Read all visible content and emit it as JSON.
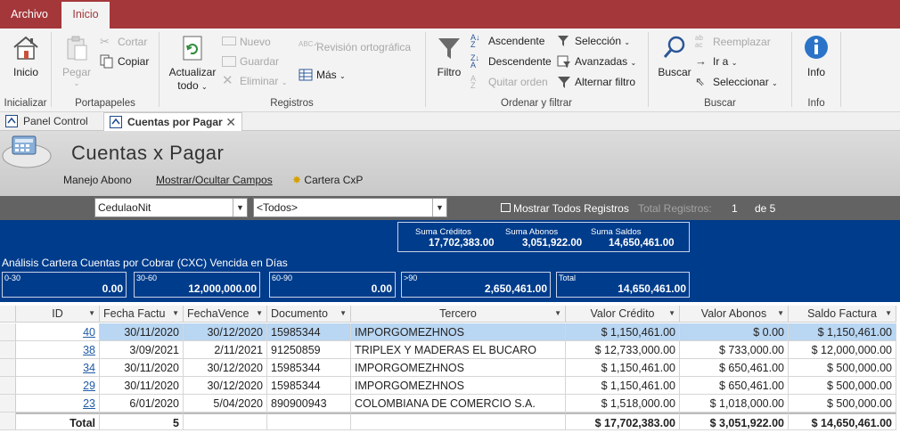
{
  "ribbon_tabs": {
    "file": "Archivo",
    "home": "Inicio"
  },
  "groups": {
    "inicializar": {
      "label": "Inicializar",
      "inicio_btn": "Inicio"
    },
    "portapapeles": {
      "label": "Portapapeles",
      "pegar": "Pegar",
      "cortar": "Cortar",
      "copiar": "Copiar"
    },
    "registros": {
      "label": "Registros",
      "actualizar_1": "Actualizar",
      "actualizar_2": "todo",
      "nuevo": "Nuevo",
      "guardar": "Guardar",
      "eliminar": "Eliminar",
      "ortografia": "Revisión ortográfica",
      "mas": "Más"
    },
    "ordenar": {
      "label": "Ordenar y filtrar",
      "filtro": "Filtro",
      "ascendente": "Ascendente",
      "descendente": "Descendente",
      "quitar": "Quitar orden",
      "seleccion": "Selección",
      "avanzadas": "Avanzadas",
      "alternar": "Alternar filtro"
    },
    "buscar": {
      "label": "Buscar",
      "buscar_btn": "Buscar",
      "reemplazar": "Reemplazar",
      "ira": "Ir a",
      "seleccionar": "Seleccionar"
    },
    "info": {
      "label": "Info",
      "info_btn": "Info"
    }
  },
  "doc_tabs": {
    "panel": "Panel Control",
    "cuentas": "Cuentas por Pagar"
  },
  "form": {
    "title": "Cuentas x Pagar",
    "btn_abono": "Manejo Abono",
    "btn_campos": "Mostrar/Ocultar Campos",
    "btn_cartera": "Cartera CxP"
  },
  "filter": {
    "field_combo": "CedulaoNit",
    "value_combo": "<Todos>",
    "show_all": "Mostrar Todos Registros",
    "total_label": "Total Registros:",
    "current": "1",
    "of_total": "de 5"
  },
  "sums": {
    "creditos_label": "Suma Créditos",
    "creditos": "17,702,383.00",
    "abonos_label": "Suma Abonos",
    "abonos": "3,051,922.00",
    "saldos_label": "Suma Saldos",
    "saldos": "14,650,461.00"
  },
  "analysis": {
    "label": "Análisis Cartera Cuentas por Cobrar (CXC) Vencida en Días",
    "b0_30_label": "0-30",
    "b0_30": "0.00",
    "b30_60_label": "30-60",
    "b30_60": "12,000,000.00",
    "b60_90_label": "60-90",
    "b60_90": "0.00",
    "b90_label": ">90",
    "b90": "2,650,461.00",
    "total_label": "Total",
    "total": "14,650,461.00"
  },
  "columns": [
    "ID",
    "Fecha Factu",
    "FechaVence",
    "Documento",
    "Tercero",
    "Valor Crédito",
    "Valor Abonos",
    "Saldo Factura"
  ],
  "rows": [
    [
      "40",
      "30/11/2020",
      "30/12/2020",
      "15985344",
      "IMPORGOMEZHNOS",
      "$ 1,150,461.00",
      "$ 0.00",
      "$ 1,150,461.00"
    ],
    [
      "38",
      "3/09/2021",
      "2/11/2021",
      "91250859",
      "TRIPLEX Y MADERAS EL BUCARO",
      "$ 12,733,000.00",
      "$ 733,000.00",
      "$ 12,000,000.00"
    ],
    [
      "34",
      "30/11/2020",
      "30/12/2020",
      "15985344",
      "IMPORGOMEZHNOS",
      "$ 1,150,461.00",
      "$ 650,461.00",
      "$ 500,000.00"
    ],
    [
      "29",
      "30/11/2020",
      "30/12/2020",
      "15985344",
      "IMPORGOMEZHNOS",
      "$ 1,150,461.00",
      "$ 650,461.00",
      "$ 500,000.00"
    ],
    [
      "23",
      "6/01/2020",
      "5/04/2020",
      "890900943",
      "COLOMBIANA DE COMERCIO S.A.",
      "$ 1,518,000.00",
      "$ 1,018,000.00",
      "$ 500,000.00"
    ]
  ],
  "totals": {
    "label": "Total",
    "count": "5",
    "credito": "$ 17,702,383.00",
    "abonos": "$ 3,051,922.00",
    "saldo": "$ 14,650,461.00"
  },
  "colors": {
    "ribbon_red": "#a4373a",
    "analysis_blue": "#003c8c",
    "selected_row": "#b9d6f2"
  }
}
